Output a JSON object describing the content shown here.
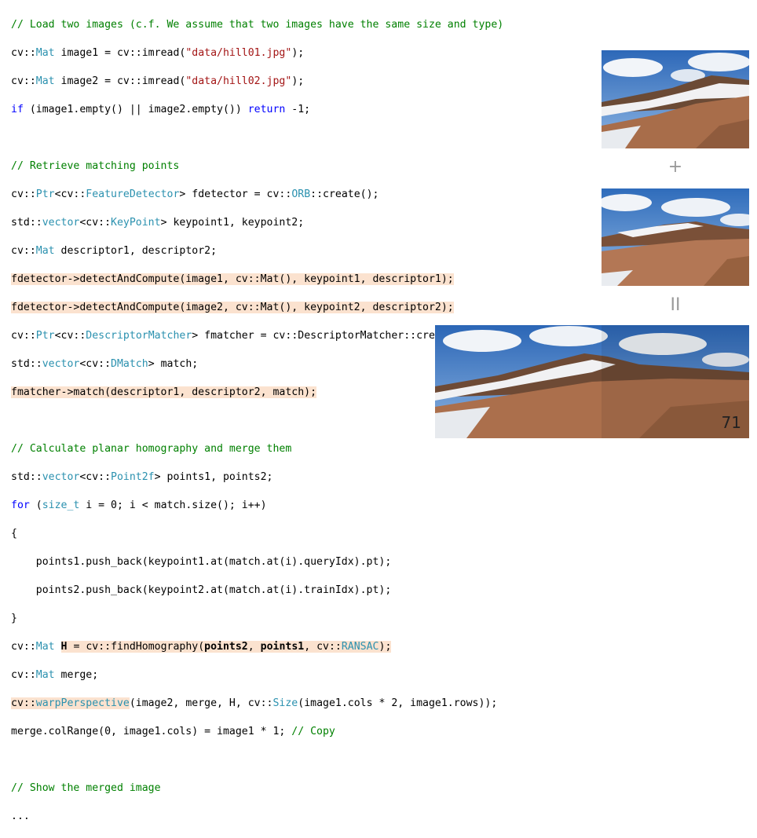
{
  "code": {
    "l01": "// Load two images (c.f. We assume that two images have the same size and type)",
    "l02a": "cv::",
    "l02b": "Mat",
    "l02c": " image1 = cv::imread(",
    "l02d": "\"data/hill01.jpg\"",
    "l02e": ");",
    "l03a": "cv::",
    "l03b": "Mat",
    "l03c": " image2 = cv::imread(",
    "l03d": "\"data/hill02.jpg\"",
    "l03e": ");",
    "l04a": "if",
    "l04b": " (image1.empty() || image2.empty()) ",
    "l04c": "return",
    "l04d": " -1;",
    "l06": "// Retrieve matching points",
    "l07a": "cv::",
    "l07b": "Ptr",
    "l07c": "<cv::",
    "l07d": "FeatureDetector",
    "l07e": "> fdetector = cv::",
    "l07f": "ORB",
    "l07g": "::create();",
    "l08a": "std::",
    "l08b": "vector",
    "l08c": "<cv::",
    "l08d": "KeyPoint",
    "l08e": "> keypoint1, keypoint2;",
    "l09a": "cv::",
    "l09b": "Mat",
    "l09c": " descriptor1, descriptor2;",
    "l10": "fdetector->detectAndCompute(image1, cv::Mat(), keypoint1, descriptor1);",
    "l11": "fdetector->detectAndCompute(image2, cv::Mat(), keypoint2, descriptor2);",
    "l12a": "cv::",
    "l12b": "Ptr",
    "l12c": "<cv::",
    "l12d": "DescriptorMatcher",
    "l12e": "> fmatcher = cv::DescriptorMatcher::create(“BruteForce-Hamming”);",
    "l13a": "std::",
    "l13b": "vector",
    "l13c": "<cv::",
    "l13d": "DMatch",
    "l13e": "> match;",
    "l14": "fmatcher->match(descriptor1, descriptor2, match);",
    "l16": "// Calculate planar homography and merge them",
    "l17a": "std::",
    "l17b": "vector",
    "l17c": "<cv::",
    "l17d": "Point2f",
    "l17e": "> points1, points2;",
    "l18a": "for",
    "l18b": " (",
    "l18c": "size_t",
    "l18d": " i = 0; i < match.size(); i++)",
    "l19": "{",
    "l20": "    points1.push_back(keypoint1.at(match.at(i).queryIdx).pt);",
    "l21": "    points2.push_back(keypoint2.at(match.at(i).trainIdx).pt);",
    "l22": "}",
    "l23a": "cv::",
    "l23b": "Mat",
    "l23c": " ",
    "l23d": "H",
    "l23e": " = cv::findHomography(",
    "l23f": "points2",
    "l23g": ", ",
    "l23h": "points1",
    "l23i": ", cv::",
    "l23j": "RANSAC",
    "l23k": ");",
    "l24a": "cv::",
    "l24b": "Mat",
    "l24c": " merge;",
    "l25a": "cv::",
    "l25b": "warpPerspective",
    "l25c": "(image2, merge, H, cv::",
    "l25d": "Size",
    "l25e": "(image1.cols * 2, image1.rows));",
    "l26a": "merge.colRange(0, image1.cols) = image1 * 1; ",
    "l26b": "// Copy",
    "l28": "// Show the merged image",
    "l29": "..."
  },
  "operators": {
    "plus": "+",
    "equals": "II"
  },
  "page_number": "71",
  "colors": {
    "comment": "#008000",
    "type": "#2b91af",
    "keyword": "#0000ff",
    "string": "#a31515",
    "highlight": "#fbe2cf"
  }
}
